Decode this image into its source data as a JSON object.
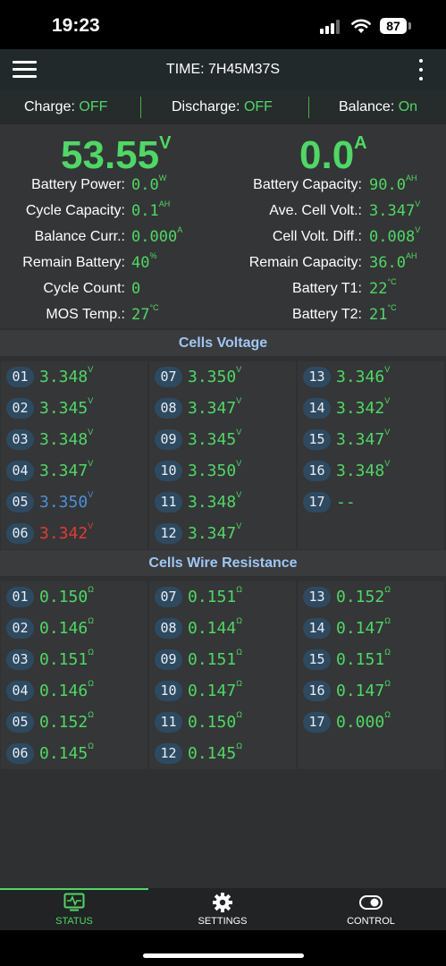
{
  "status_bar": {
    "time": "19:23",
    "battery": "87"
  },
  "header": {
    "title": "TIME: 7H45M37S"
  },
  "switches": [
    {
      "label": "Charge:",
      "value": "OFF"
    },
    {
      "label": "Discharge:",
      "value": "OFF"
    },
    {
      "label": "Balance:",
      "value": "On"
    }
  ],
  "summary": {
    "voltage": "53.55",
    "voltage_unit": "V",
    "current": "0.0",
    "current_unit": "A",
    "left": [
      {
        "label": "Battery Power:",
        "value": "0.0",
        "unit": "W"
      },
      {
        "label": "Cycle Capacity:",
        "value": "0.1",
        "unit": "AH"
      },
      {
        "label": "Balance Curr.:",
        "value": "0.000",
        "unit": "A"
      },
      {
        "label": "Remain Battery:",
        "value": "40",
        "unit": "%"
      },
      {
        "label": "Cycle Count:",
        "value": "0",
        "unit": ""
      },
      {
        "label": "MOS Temp.:",
        "value": "27",
        "unit": "°C"
      }
    ],
    "right": [
      {
        "label": "Battery Capacity:",
        "value": "90.0",
        "unit": "AH"
      },
      {
        "label": "Ave. Cell Volt.:",
        "value": "3.347",
        "unit": "V"
      },
      {
        "label": "Cell Volt. Diff.:",
        "value": "0.008",
        "unit": "V"
      },
      {
        "label": "Remain Capacity:",
        "value": "36.0",
        "unit": "AH"
      },
      {
        "label": "Battery T1:",
        "value": "22",
        "unit": "°C"
      },
      {
        "label": "Battery T2:",
        "value": "21",
        "unit": "°C"
      }
    ]
  },
  "cells_voltage": {
    "title": "Cells Voltage",
    "unit": "V",
    "cells": [
      {
        "idx": "01",
        "value": "3.348",
        "state": "normal"
      },
      {
        "idx": "02",
        "value": "3.345",
        "state": "normal"
      },
      {
        "idx": "03",
        "value": "3.348",
        "state": "normal"
      },
      {
        "idx": "04",
        "value": "3.347",
        "state": "normal"
      },
      {
        "idx": "05",
        "value": "3.350",
        "state": "max"
      },
      {
        "idx": "06",
        "value": "3.342",
        "state": "min"
      },
      {
        "idx": "07",
        "value": "3.350",
        "state": "normal"
      },
      {
        "idx": "08",
        "value": "3.347",
        "state": "normal"
      },
      {
        "idx": "09",
        "value": "3.345",
        "state": "normal"
      },
      {
        "idx": "10",
        "value": "3.350",
        "state": "normal"
      },
      {
        "idx": "11",
        "value": "3.348",
        "state": "normal"
      },
      {
        "idx": "12",
        "value": "3.347",
        "state": "normal"
      },
      {
        "idx": "13",
        "value": "3.346",
        "state": "normal"
      },
      {
        "idx": "14",
        "value": "3.342",
        "state": "normal"
      },
      {
        "idx": "15",
        "value": "3.347",
        "state": "normal"
      },
      {
        "idx": "16",
        "value": "3.348",
        "state": "normal"
      },
      {
        "idx": "17",
        "value": "--",
        "state": "empty"
      }
    ]
  },
  "cells_resistance": {
    "title": "Cells Wire Resistance",
    "unit": "Ω",
    "cells": [
      {
        "idx": "01",
        "value": "0.150"
      },
      {
        "idx": "02",
        "value": "0.146"
      },
      {
        "idx": "03",
        "value": "0.151"
      },
      {
        "idx": "04",
        "value": "0.146"
      },
      {
        "idx": "05",
        "value": "0.152"
      },
      {
        "idx": "06",
        "value": "0.145"
      },
      {
        "idx": "07",
        "value": "0.151"
      },
      {
        "idx": "08",
        "value": "0.144"
      },
      {
        "idx": "09",
        "value": "0.151"
      },
      {
        "idx": "10",
        "value": "0.147"
      },
      {
        "idx": "11",
        "value": "0.150"
      },
      {
        "idx": "12",
        "value": "0.145"
      },
      {
        "idx": "13",
        "value": "0.152"
      },
      {
        "idx": "14",
        "value": "0.147"
      },
      {
        "idx": "15",
        "value": "0.151"
      },
      {
        "idx": "16",
        "value": "0.147"
      },
      {
        "idx": "17",
        "value": "0.000"
      }
    ]
  },
  "tabs": [
    {
      "label": "STATUS",
      "icon": "pulse-monitor-icon",
      "active": true
    },
    {
      "label": "SETTINGS",
      "icon": "gear-icon",
      "active": false
    },
    {
      "label": "CONTROL",
      "icon": "toggle-icon",
      "active": false
    }
  ],
  "colors": {
    "accent": "#4cd964",
    "section_title": "#9fc6f5",
    "max_cell": "#4a90d9",
    "min_cell": "#e53935"
  }
}
